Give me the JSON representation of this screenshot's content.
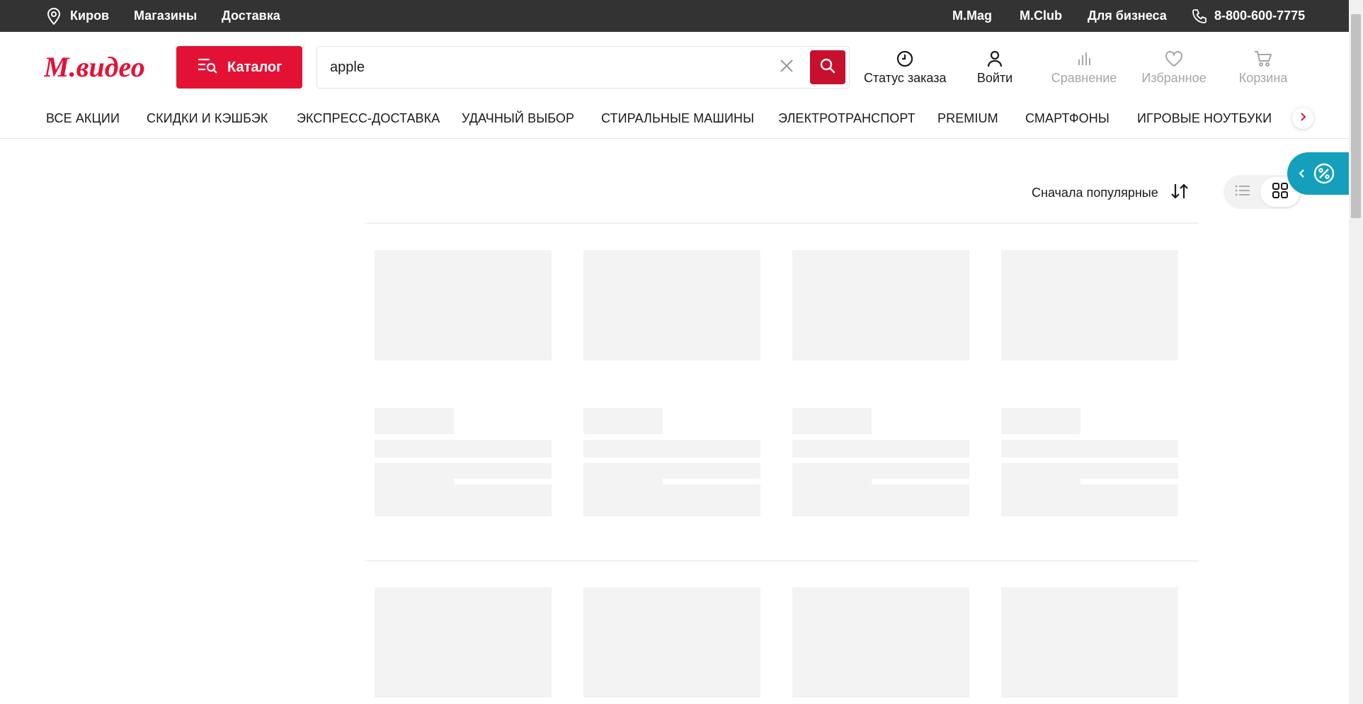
{
  "topbar": {
    "city": "Киров",
    "links_left": [
      "Магазины",
      "Доставка"
    ],
    "links_right": [
      "M.Mag",
      "M.Club",
      "Для бизнеса"
    ],
    "phone": "8-800-600-7775"
  },
  "header": {
    "logo_text": "М.видео",
    "catalog_label": "Каталог",
    "search_value": "apple",
    "actions": [
      {
        "label": "Статус заказа",
        "icon": "clock-icon",
        "muted": false
      },
      {
        "label": "Войти",
        "icon": "user-icon",
        "muted": false
      },
      {
        "label": "Сравнение",
        "icon": "compare-icon",
        "muted": true
      },
      {
        "label": "Избранное",
        "icon": "heart-icon",
        "muted": true
      },
      {
        "label": "Корзина",
        "icon": "cart-icon",
        "muted": true
      }
    ]
  },
  "categories": [
    "ВСЕ АКЦИИ",
    "СКИДКИ И КЭШБЭК",
    "ЭКСПРЕСС-ДОСТАВКА",
    "УДАЧНЫЙ ВЫБОР",
    "СТИРАЛЬНЫЕ МАШИНЫ",
    "ЭЛЕКТРОТРАНСПОРТ",
    "PREMIUM",
    "СМАРТФОНЫ",
    "ИГРОВЫЕ НОУТБУКИ"
  ],
  "listing": {
    "sort_label": "Сначала популярные",
    "view_mode": "grid"
  },
  "colors": {
    "brand_red": "#e31235",
    "topbar_bg": "#333333",
    "promo_tab": "#14a0bc"
  }
}
